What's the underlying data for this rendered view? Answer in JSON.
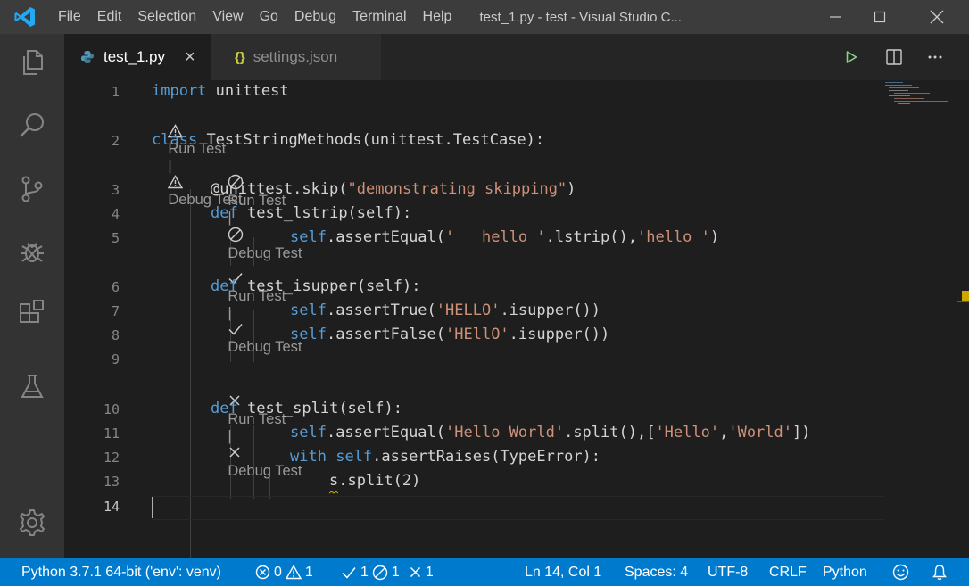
{
  "titlebar": {
    "menu": [
      "File",
      "Edit",
      "Selection",
      "View",
      "Go",
      "Debug",
      "Terminal",
      "Help"
    ],
    "window_title": "test_1.py - test - Visual Studio C...",
    "controls": [
      "minimize-icon",
      "maximize-icon",
      "close-icon"
    ]
  },
  "activitybar": {
    "icons": [
      "explorer-icon",
      "search-icon",
      "source-control-icon",
      "debug-icon",
      "extensions-icon",
      "test-icon",
      "settings-gear-icon"
    ]
  },
  "tabs": [
    {
      "label": "test_1.py",
      "icon": "python-icon",
      "active": true,
      "close": "×"
    },
    {
      "label": "settings.json",
      "icon": "json-braces-icon",
      "active": false,
      "glyph": "{}"
    }
  ],
  "editor": {
    "lines": {
      "1": "1",
      "2": "2",
      "3": "3",
      "4": "4",
      "5": "5",
      "6": "6",
      "7": "7",
      "8": "8",
      "9": "9",
      "10": "10",
      "11": "11",
      "12": "12",
      "13": "13",
      "14": "14"
    },
    "codelens": {
      "class": {
        "run": "Run Test",
        "debug": "Debug Test",
        "sep": "|",
        "status": "warning"
      },
      "skip": {
        "run": "Run Test",
        "debug": "Debug Test",
        "sep": "|",
        "status": "skipped"
      },
      "isupper": {
        "run": "Run Test",
        "debug": "Debug Test",
        "sep": "|",
        "status": "passed"
      },
      "split": {
        "run": "Run Test",
        "debug": "Debug Test",
        "sep": "|",
        "status": "failed"
      }
    },
    "code": {
      "l1_kw": "import",
      "l1_mod": "unittest",
      "l2_kw": "class",
      "l2_cls": "TestStringMethods(unittest.TestCase):",
      "l3_dec": "@unittest.skip(",
      "l3_str": "\"demonstrating skipping\"",
      "l3_end": ")",
      "l4_kw": "def",
      "l4_fn": "test_lstrip(self):",
      "l5_self": "self",
      "l5_call": ".assertEqual(",
      "l5_str1": "'   hello '",
      "l5_mid": ".lstrip(),",
      "l5_str2": "'hello '",
      "l5_end": ")",
      "l6_kw": "def",
      "l6_fn": "test_isupper(self):",
      "l7_self": "self",
      "l7_call": ".assertTrue(",
      "l7_str": "'HELLO'",
      "l7_end": ".isupper())",
      "l8_self": "self",
      "l8_call": ".assertFalse(",
      "l8_str": "'HEllO'",
      "l8_end": ".isupper())",
      "l10_kw": "def",
      "l10_fn": "test_split(self):",
      "l11_self": "self",
      "l11_call": ".assertEqual(",
      "l11_str1": "'Hello World'",
      "l11_mid": ".split(),[",
      "l11_str2": "'Hello'",
      "l11_comma": ",",
      "l11_str3": "'World'",
      "l11_end": "])",
      "l12_kw": "with",
      "l12_self": "self",
      "l12_end": ".assertRaises(TypeError):",
      "l13": "s.split(2)"
    }
  },
  "statusbar": {
    "interpreter": "Python 3.7.1 64-bit ('env': venv)",
    "errors": "0",
    "warnings": "1",
    "tests_passed": "1",
    "tests_skipped": "1",
    "tests_failed": "1",
    "position": "Ln 14, Col 1",
    "spaces": "Spaces: 4",
    "encoding": "UTF-8",
    "eol": "CRLF",
    "language": "Python"
  },
  "colors": {
    "accent": "#007acc",
    "run_green": "#89d185",
    "logo_blue": "#23a9f2",
    "json_yellow": "#cbcb41"
  }
}
